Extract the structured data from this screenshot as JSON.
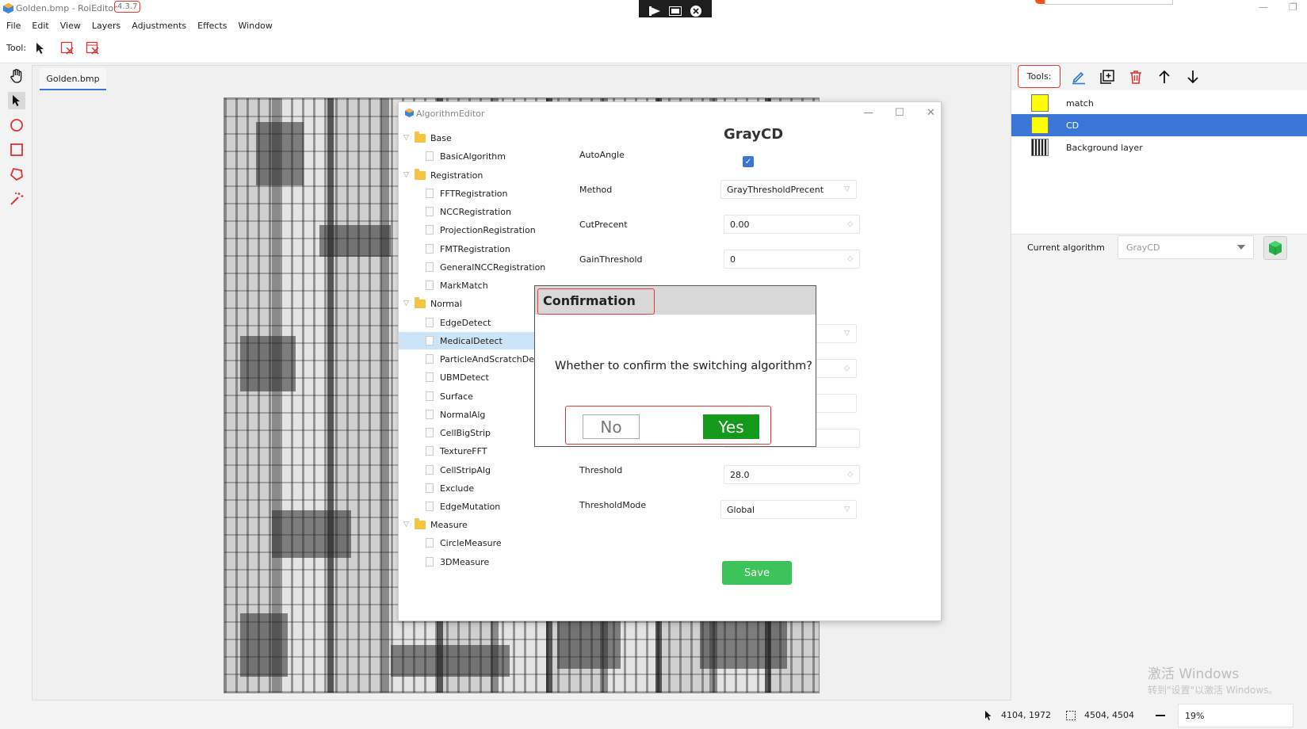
{
  "window": {
    "title": "Golden.bmp - RoiEditor",
    "version": "4.3.7",
    "minimize_glyph": "—",
    "restore_glyph": "❐"
  },
  "recording_bar": {
    "icons": [
      "record-icon",
      "screen-icon",
      "close-icon"
    ]
  },
  "menu": [
    "File",
    "Edit",
    "View",
    "Layers",
    "Adjustments",
    "Effects",
    "Window"
  ],
  "toolbar": {
    "label": "Tool:"
  },
  "left_tools": [
    "hand-icon",
    "pointer-icon",
    "circle-icon",
    "rectangle-icon",
    "polygon-icon",
    "magic-wand-icon"
  ],
  "document_tab": "Golden.bmp",
  "algorithm_editor": {
    "title": "AlgorithmEditor",
    "minimize": "—",
    "maximize": "☐",
    "close": "✕",
    "heading": "GrayCD",
    "tree": [
      {
        "label": "Base",
        "type": "folder"
      },
      {
        "label": "BasicAlgorithm",
        "type": "item"
      },
      {
        "label": "Registration",
        "type": "folder"
      },
      {
        "label": "FFTRegistration",
        "type": "item"
      },
      {
        "label": "NCCRegistration",
        "type": "item"
      },
      {
        "label": "ProjectionRegistration",
        "type": "item"
      },
      {
        "label": "FMTRegistration",
        "type": "item"
      },
      {
        "label": "GeneralNCCRegistration",
        "type": "item"
      },
      {
        "label": "MarkMatch",
        "type": "item"
      },
      {
        "label": "Normal",
        "type": "folder"
      },
      {
        "label": "EdgeDetect",
        "type": "item"
      },
      {
        "label": "MedicalDetect",
        "type": "item",
        "selected": true
      },
      {
        "label": "ParticleAndScratchDete",
        "type": "item"
      },
      {
        "label": "UBMDetect",
        "type": "item"
      },
      {
        "label": "Surface",
        "type": "item"
      },
      {
        "label": "NormalAlg",
        "type": "item"
      },
      {
        "label": "CellBigStrip",
        "type": "item"
      },
      {
        "label": "TextureFFT",
        "type": "item"
      },
      {
        "label": "CellStripAlg",
        "type": "item"
      },
      {
        "label": "Exclude",
        "type": "item"
      },
      {
        "label": "EdgeMutation",
        "type": "item"
      },
      {
        "label": "Measure",
        "type": "folder"
      },
      {
        "label": "CircleMeasure",
        "type": "item"
      },
      {
        "label": "3DMeasure",
        "type": "item"
      }
    ],
    "params": {
      "autoangle_label": "AutoAngle",
      "autoangle_checked": true,
      "method_label": "Method",
      "method_value": "GrayThresholdPrecent",
      "cutprecent_label": "CutPrecent",
      "cutprecent_value": "0.00",
      "gainthreshold_label": "GainThreshold",
      "gainthreshold_value": "0",
      "threshold_label": "Threshold",
      "threshold_value": "28.0",
      "thresholdmode_label": "ThresholdMode",
      "thresholdmode_value": "Global"
    },
    "save_label": "Save"
  },
  "confirmation": {
    "title": "Confirmation",
    "message": "Whether to confirm the switching algorithm?",
    "no_label": "No",
    "yes_label": "Yes"
  },
  "right_panel": {
    "tools_label": "Tools:",
    "tool_icons": [
      "pencil-icon",
      "add-layer-icon",
      "trash-icon",
      "arrow-up-icon",
      "arrow-down-icon"
    ],
    "layers": [
      {
        "name": "match",
        "swatch": "#ffff00",
        "selected": false
      },
      {
        "name": "CD",
        "swatch": "#ffff00",
        "selected": true
      },
      {
        "name": "Background layer",
        "swatch": "image",
        "selected": false
      }
    ],
    "current_algorithm_label": "Current algorithm",
    "current_algorithm_value": "GrayCD"
  },
  "status": {
    "cursor_pos": "4104, 1972",
    "image_size": "4504, 4504",
    "zoom": "19%"
  },
  "watermark": {
    "line1": "激活 Windows",
    "line2": "转到\"设置\"以激活 Windows。"
  },
  "colors": {
    "accent": "#3a76d8",
    "highlight_red": "#e53935",
    "yes_green": "#139a1a",
    "save_green": "#3cc45a",
    "layer_yellow": "#ffff00"
  }
}
